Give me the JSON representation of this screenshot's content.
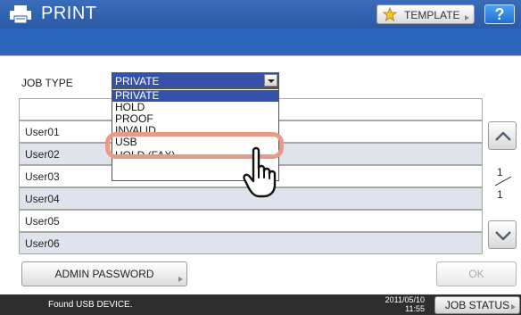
{
  "header": {
    "title": "PRINT",
    "template_label": "TEMPLATE",
    "help_label": "?"
  },
  "job_type": {
    "label": "JOB TYPE",
    "selected": "PRIVATE",
    "options": [
      "PRIVATE",
      "HOLD",
      "PROOF",
      "INVALID",
      "USB",
      "HOLD (FAX)"
    ]
  },
  "users": [
    "User01",
    "User02",
    "User03",
    "User04",
    "User05",
    "User06"
  ],
  "pager": {
    "current": "1",
    "total": "1"
  },
  "buttons": {
    "admin_password": "ADMIN PASSWORD",
    "ok": "OK",
    "job_status": "JOB STATUS"
  },
  "status": {
    "message": "Found USB DEVICE.",
    "date": "2011/05/10",
    "time": "11:55"
  },
  "colors": {
    "title_bar": "#2f66bd",
    "highlight": "#e89a84",
    "selected_option": "#3552a8"
  }
}
